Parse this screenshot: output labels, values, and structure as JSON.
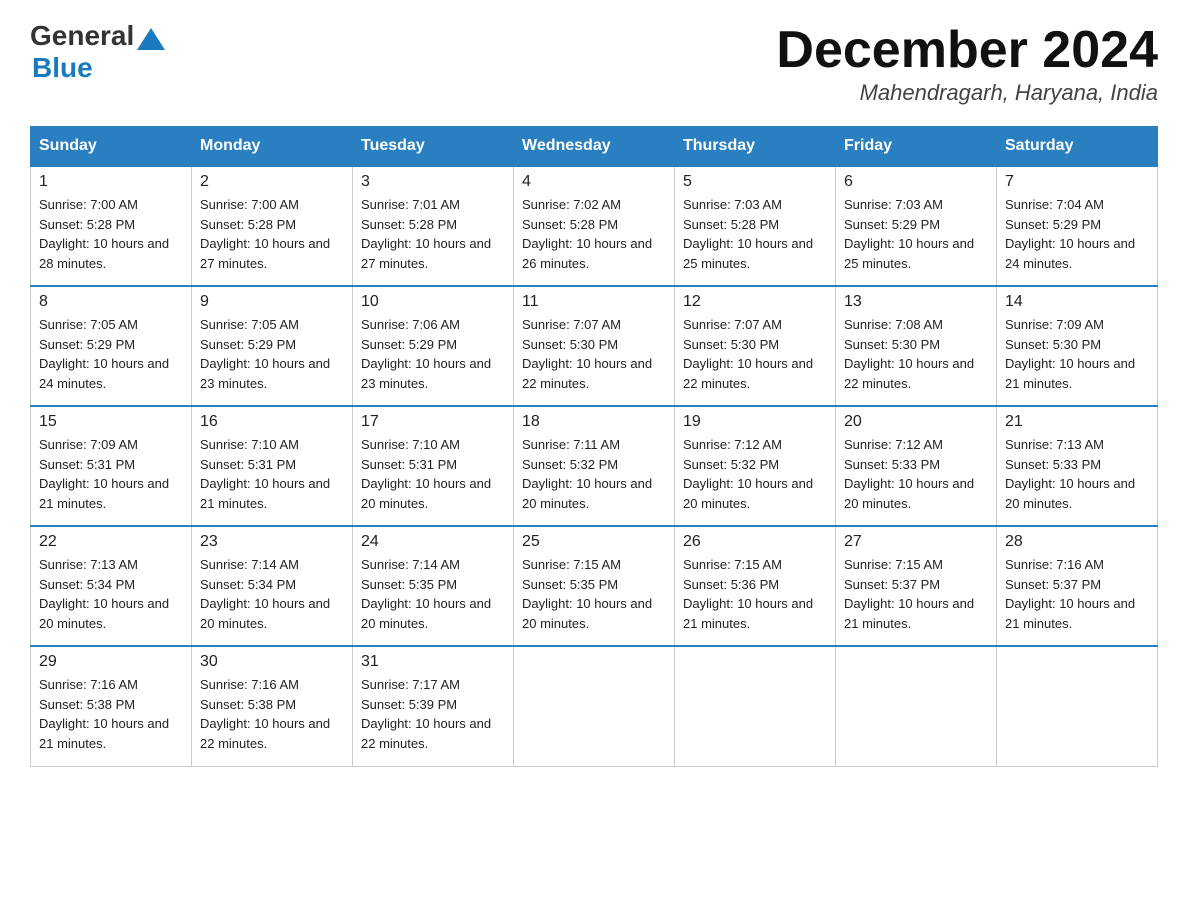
{
  "header": {
    "logo_general": "General",
    "logo_blue": "Blue",
    "month_title": "December 2024",
    "location": "Mahendragarh, Haryana, India"
  },
  "weekdays": [
    "Sunday",
    "Monday",
    "Tuesday",
    "Wednesday",
    "Thursday",
    "Friday",
    "Saturday"
  ],
  "weeks": [
    [
      {
        "day": "1",
        "sunrise": "7:00 AM",
        "sunset": "5:28 PM",
        "daylight": "10 hours and 28 minutes."
      },
      {
        "day": "2",
        "sunrise": "7:00 AM",
        "sunset": "5:28 PM",
        "daylight": "10 hours and 27 minutes."
      },
      {
        "day": "3",
        "sunrise": "7:01 AM",
        "sunset": "5:28 PM",
        "daylight": "10 hours and 27 minutes."
      },
      {
        "day": "4",
        "sunrise": "7:02 AM",
        "sunset": "5:28 PM",
        "daylight": "10 hours and 26 minutes."
      },
      {
        "day": "5",
        "sunrise": "7:03 AM",
        "sunset": "5:28 PM",
        "daylight": "10 hours and 25 minutes."
      },
      {
        "day": "6",
        "sunrise": "7:03 AM",
        "sunset": "5:29 PM",
        "daylight": "10 hours and 25 minutes."
      },
      {
        "day": "7",
        "sunrise": "7:04 AM",
        "sunset": "5:29 PM",
        "daylight": "10 hours and 24 minutes."
      }
    ],
    [
      {
        "day": "8",
        "sunrise": "7:05 AM",
        "sunset": "5:29 PM",
        "daylight": "10 hours and 24 minutes."
      },
      {
        "day": "9",
        "sunrise": "7:05 AM",
        "sunset": "5:29 PM",
        "daylight": "10 hours and 23 minutes."
      },
      {
        "day": "10",
        "sunrise": "7:06 AM",
        "sunset": "5:29 PM",
        "daylight": "10 hours and 23 minutes."
      },
      {
        "day": "11",
        "sunrise": "7:07 AM",
        "sunset": "5:30 PM",
        "daylight": "10 hours and 22 minutes."
      },
      {
        "day": "12",
        "sunrise": "7:07 AM",
        "sunset": "5:30 PM",
        "daylight": "10 hours and 22 minutes."
      },
      {
        "day": "13",
        "sunrise": "7:08 AM",
        "sunset": "5:30 PM",
        "daylight": "10 hours and 22 minutes."
      },
      {
        "day": "14",
        "sunrise": "7:09 AM",
        "sunset": "5:30 PM",
        "daylight": "10 hours and 21 minutes."
      }
    ],
    [
      {
        "day": "15",
        "sunrise": "7:09 AM",
        "sunset": "5:31 PM",
        "daylight": "10 hours and 21 minutes."
      },
      {
        "day": "16",
        "sunrise": "7:10 AM",
        "sunset": "5:31 PM",
        "daylight": "10 hours and 21 minutes."
      },
      {
        "day": "17",
        "sunrise": "7:10 AM",
        "sunset": "5:31 PM",
        "daylight": "10 hours and 20 minutes."
      },
      {
        "day": "18",
        "sunrise": "7:11 AM",
        "sunset": "5:32 PM",
        "daylight": "10 hours and 20 minutes."
      },
      {
        "day": "19",
        "sunrise": "7:12 AM",
        "sunset": "5:32 PM",
        "daylight": "10 hours and 20 minutes."
      },
      {
        "day": "20",
        "sunrise": "7:12 AM",
        "sunset": "5:33 PM",
        "daylight": "10 hours and 20 minutes."
      },
      {
        "day": "21",
        "sunrise": "7:13 AM",
        "sunset": "5:33 PM",
        "daylight": "10 hours and 20 minutes."
      }
    ],
    [
      {
        "day": "22",
        "sunrise": "7:13 AM",
        "sunset": "5:34 PM",
        "daylight": "10 hours and 20 minutes."
      },
      {
        "day": "23",
        "sunrise": "7:14 AM",
        "sunset": "5:34 PM",
        "daylight": "10 hours and 20 minutes."
      },
      {
        "day": "24",
        "sunrise": "7:14 AM",
        "sunset": "5:35 PM",
        "daylight": "10 hours and 20 minutes."
      },
      {
        "day": "25",
        "sunrise": "7:15 AM",
        "sunset": "5:35 PM",
        "daylight": "10 hours and 20 minutes."
      },
      {
        "day": "26",
        "sunrise": "7:15 AM",
        "sunset": "5:36 PM",
        "daylight": "10 hours and 21 minutes."
      },
      {
        "day": "27",
        "sunrise": "7:15 AM",
        "sunset": "5:37 PM",
        "daylight": "10 hours and 21 minutes."
      },
      {
        "day": "28",
        "sunrise": "7:16 AM",
        "sunset": "5:37 PM",
        "daylight": "10 hours and 21 minutes."
      }
    ],
    [
      {
        "day": "29",
        "sunrise": "7:16 AM",
        "sunset": "5:38 PM",
        "daylight": "10 hours and 21 minutes."
      },
      {
        "day": "30",
        "sunrise": "7:16 AM",
        "sunset": "5:38 PM",
        "daylight": "10 hours and 22 minutes."
      },
      {
        "day": "31",
        "sunrise": "7:17 AM",
        "sunset": "5:39 PM",
        "daylight": "10 hours and 22 minutes."
      },
      null,
      null,
      null,
      null
    ]
  ]
}
